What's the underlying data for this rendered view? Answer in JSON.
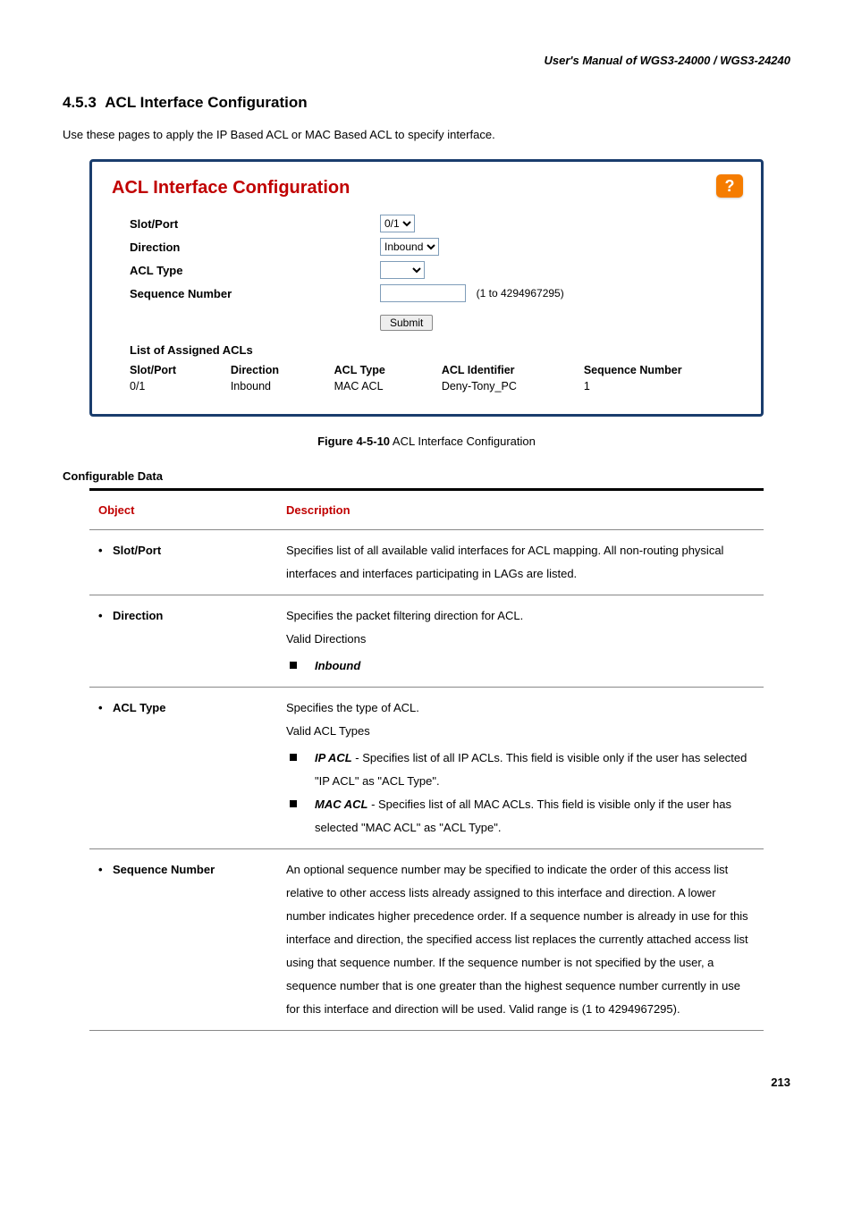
{
  "header": "User's  Manual  of  WGS3-24000  /  WGS3-24240",
  "section": {
    "number": "4.5.3",
    "title": "ACL Interface Configuration"
  },
  "intro": "Use these pages to apply the IP Based ACL or MAC Based ACL to specify interface.",
  "screenshot": {
    "title": "ACL Interface Configuration",
    "help_glyph": "?",
    "fields": {
      "slot_port": {
        "label": "Slot/Port",
        "value": "0/1"
      },
      "direction": {
        "label": "Direction",
        "value": "Inbound"
      },
      "acl_type": {
        "label": "ACL Type",
        "value": ""
      },
      "seq_num": {
        "label": "Sequence Number",
        "value": "",
        "hint": "(1 to 4294967295)"
      }
    },
    "submit_label": "Submit",
    "list_heading": "List of Assigned ACLs",
    "list_headers": [
      "Slot/Port",
      "Direction",
      "ACL Type",
      "ACL Identifier",
      "Sequence Number"
    ],
    "list_rows": [
      {
        "slot_port": "0/1",
        "direction": "Inbound",
        "acl_type": "MAC ACL",
        "acl_id": "Deny-Tony_PC",
        "seq": "1"
      }
    ]
  },
  "figure_caption": {
    "bold": "Figure 4-5-10",
    "rest": " ACL Interface Configuration"
  },
  "config_data_heading": "Configurable Data",
  "table": {
    "headers": {
      "object": "Object",
      "description": "Description"
    },
    "rows": [
      {
        "object": "Slot/Port",
        "desc_plain": "Specifies list of all available valid interfaces for ACL mapping. All non-routing physical interfaces and interfaces participating in LAGs are listed."
      },
      {
        "object": "Direction",
        "desc_lead": "Specifies the packet filtering direction for ACL.",
        "desc_sub": "Valid Directions",
        "bullets": [
          {
            "bold_italic": "Inbound",
            "rest": ""
          }
        ]
      },
      {
        "object": "ACL Type",
        "desc_lead": "Specifies the type of ACL.",
        "desc_sub": "Valid ACL Types",
        "bullets": [
          {
            "bold_italic": "IP ACL",
            "rest": " - Specifies list of all IP ACLs. This field is visible only if the user has selected \"IP ACL\" as \"ACL Type\"."
          },
          {
            "bold_italic": "MAC ACL",
            "rest": " - Specifies list of all MAC ACLs. This field is visible only if the user has selected \"MAC ACL\" as \"ACL Type\"."
          }
        ]
      },
      {
        "object": "Sequence Number",
        "desc_plain": "An optional sequence number may be specified to indicate the order of this access list relative to other access lists already assigned to this interface and direction. A lower number indicates higher precedence order. If a sequence number is already in use for this interface and direction, the specified access list replaces the currently attached access list using that sequence number. If the sequence number is not specified by the user, a sequence number that is one greater than the highest sequence number currently in use for this interface and direction will be used. Valid range is (1 to 4294967295)."
      }
    ]
  },
  "page_number": "213",
  "chart_data": null
}
